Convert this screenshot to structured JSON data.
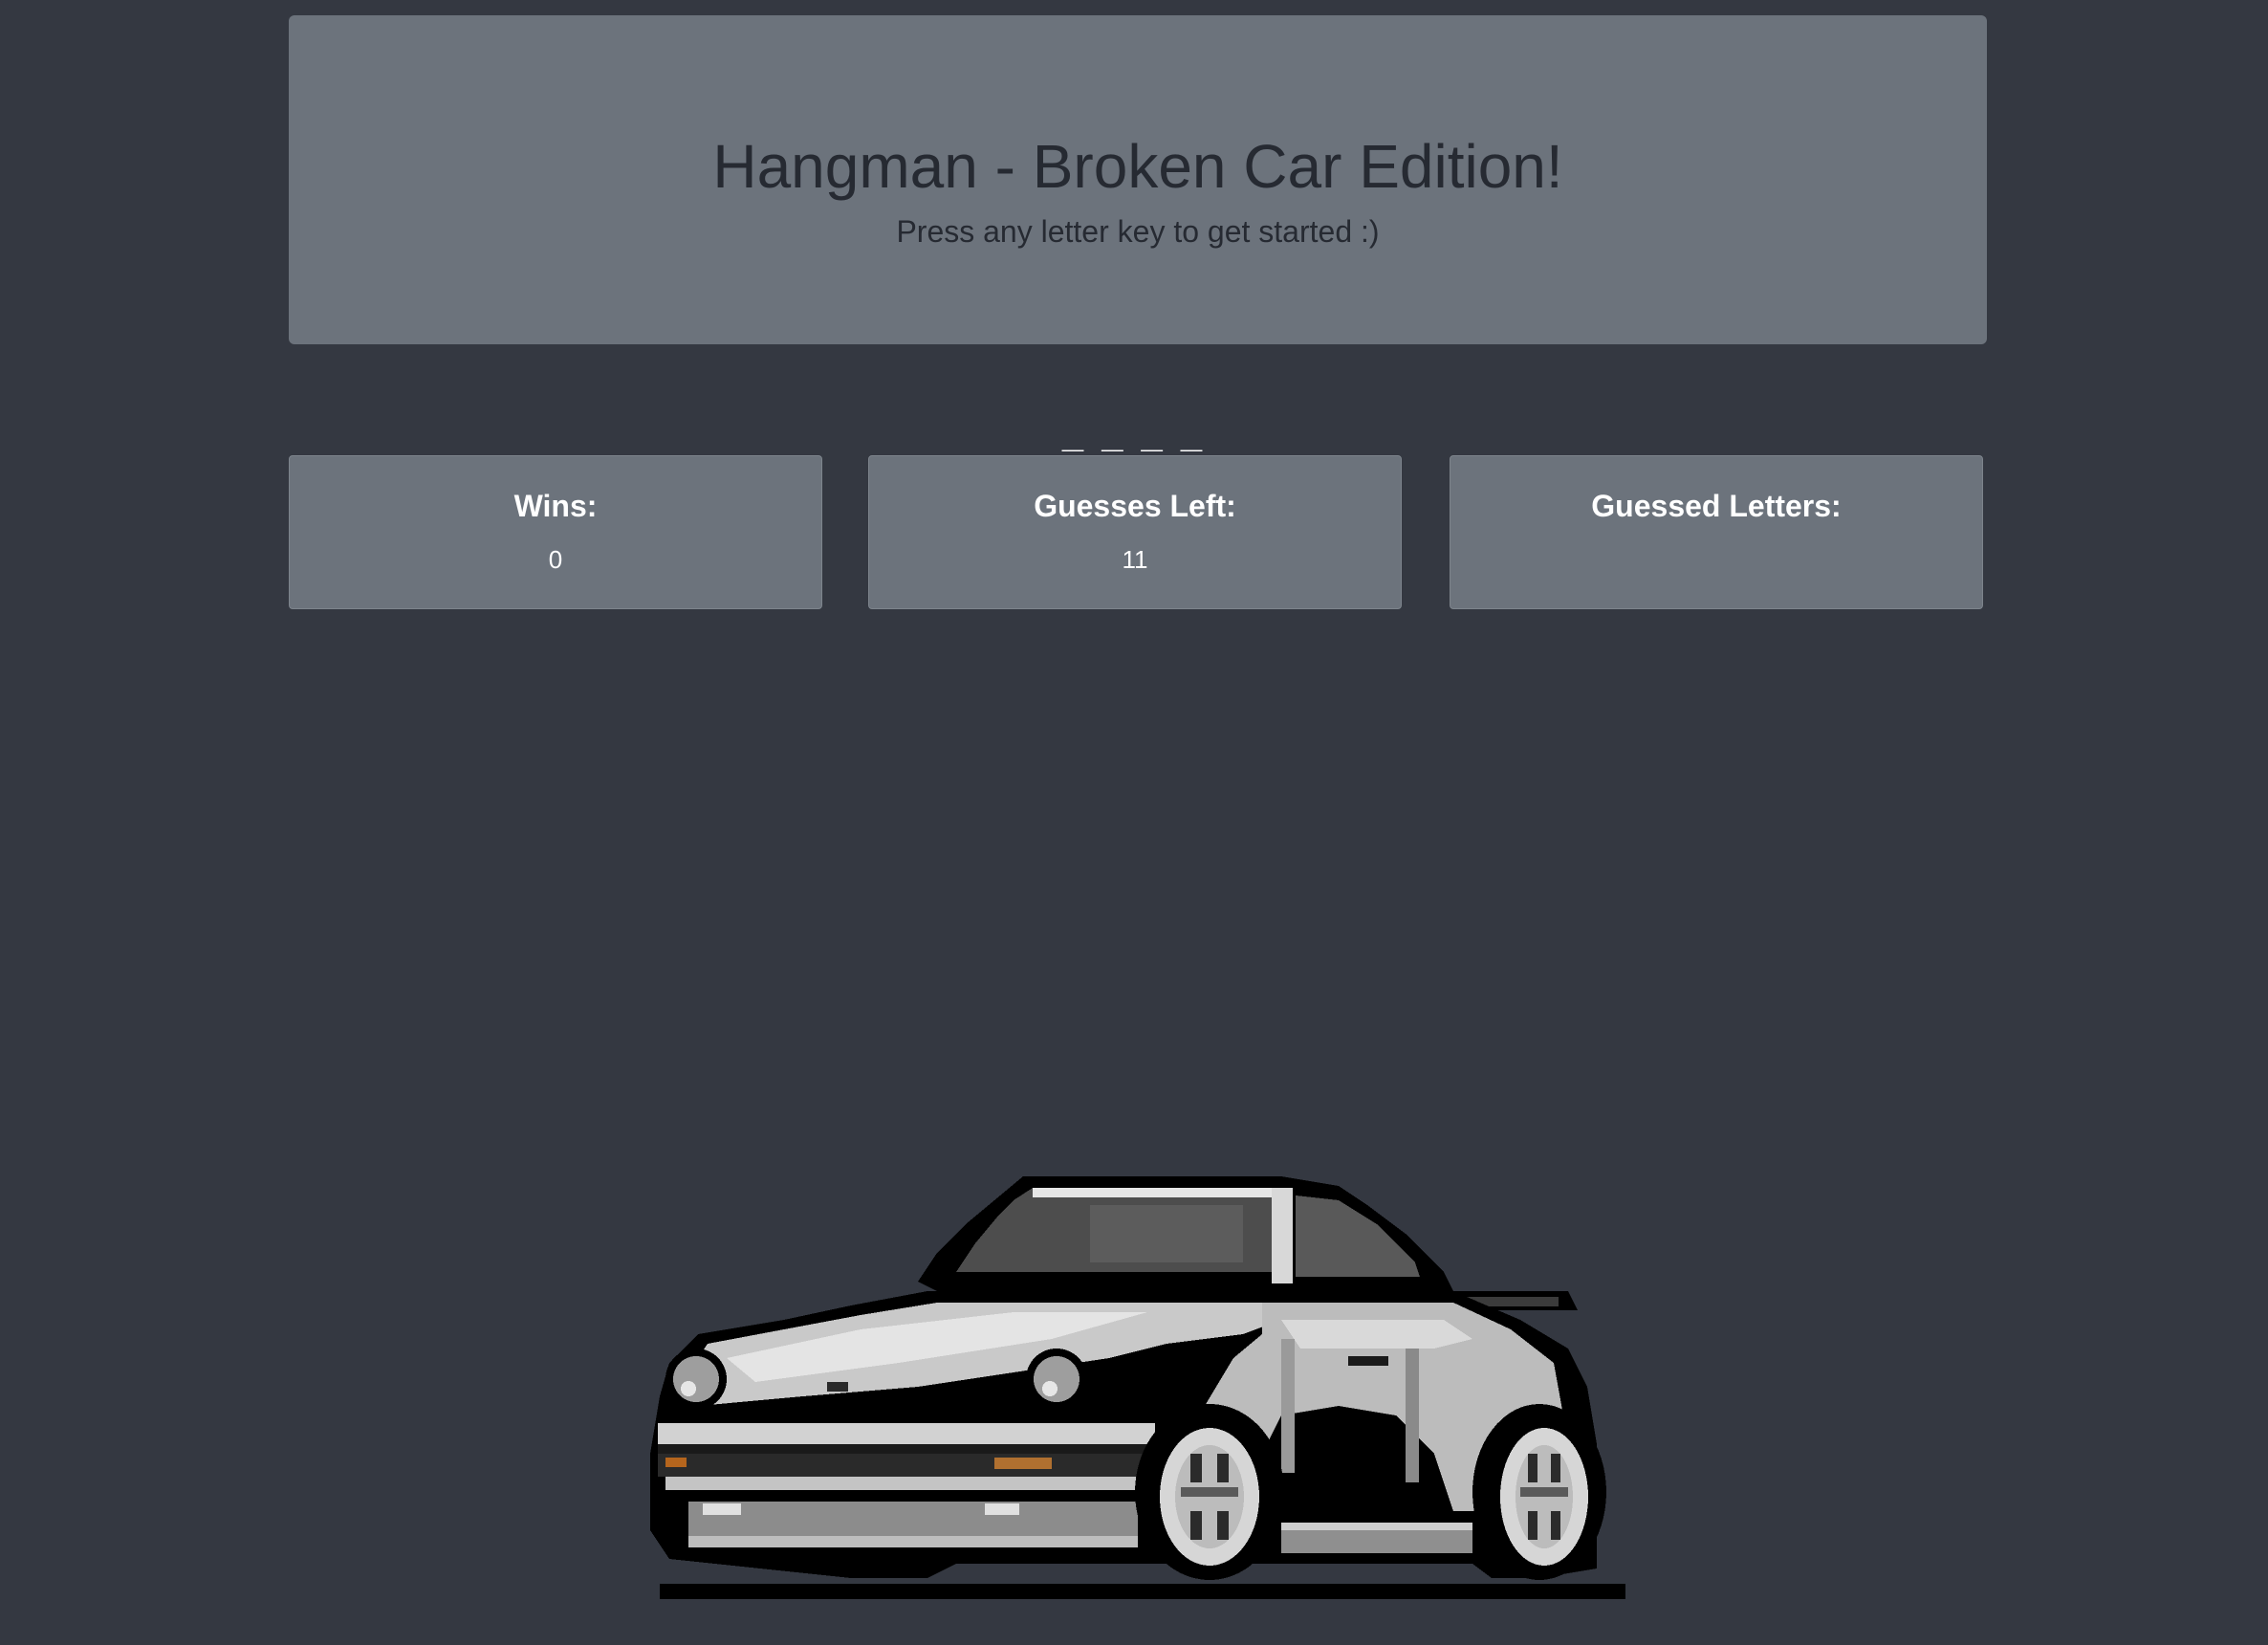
{
  "header": {
    "title": "Hangman - Broken Car Edition!",
    "subtitle": "Press any letter key to get started :)"
  },
  "game": {
    "word_display": "_ _ _ _",
    "stats": {
      "wins_label": "Wins:",
      "wins_value": "0",
      "guesses_left_label": "Guesses Left:",
      "guesses_left_value": "11",
      "guessed_letters_label": "Guessed Letters:",
      "guessed_letters_value": ""
    }
  },
  "colors": {
    "background": "#343841",
    "panel": "#6c737c",
    "title_text": "#262a32",
    "stat_text": "#ffffff"
  },
  "image": {
    "icon": "pixel-car-icon"
  }
}
